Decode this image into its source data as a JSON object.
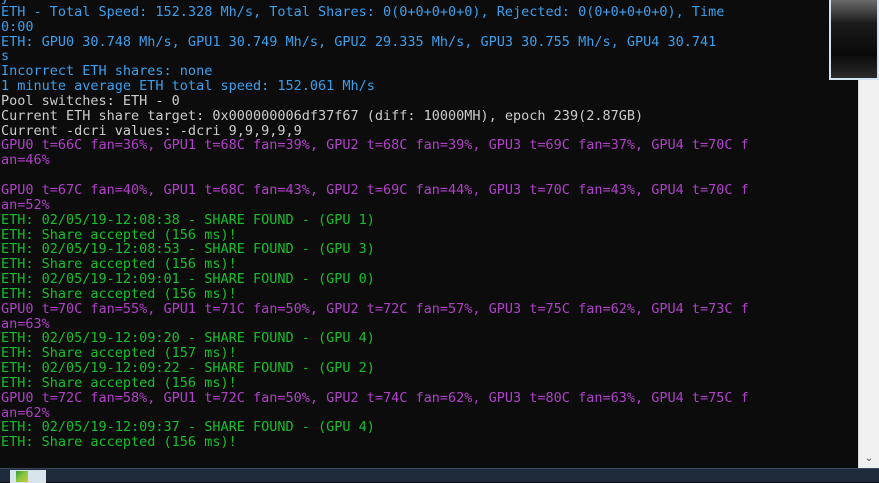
{
  "console": {
    "lines": [
      {
        "text": "y",
        "color": "blue"
      },
      {
        "text": "ETH - Total Speed: 152.328 Mh/s, Total Shares: 0(0+0+0+0+0), Rejected: 0(0+0+0+0+0), Time",
        "color": "blue"
      },
      {
        "text": "0:00",
        "color": "blue"
      },
      {
        "text": "ETH: GPU0 30.748 Mh/s, GPU1 30.749 Mh/s, GPU2 29.335 Mh/s, GPU3 30.755 Mh/s, GPU4 30.741",
        "color": "blue"
      },
      {
        "text": "s",
        "color": "blue"
      },
      {
        "text": "Incorrect ETH shares: none",
        "color": "blue"
      },
      {
        "text": "1 minute average ETH total speed: 152.061 Mh/s",
        "color": "blue"
      },
      {
        "text": "Pool switches: ETH - 0",
        "color": "white"
      },
      {
        "text": "Current ETH share target: 0x000000006df37f67 (diff: 10000MH), epoch 239(2.87GB)",
        "color": "white"
      },
      {
        "text": "Current -dcri values: -dcri 9,9,9,9,9",
        "color": "white"
      },
      {
        "text": "GPU0 t=66C fan=36%, GPU1 t=68C fan=39%, GPU2 t=68C fan=39%, GPU3 t=69C fan=37%, GPU4 t=70C f",
        "color": "purple"
      },
      {
        "text": "an=46%",
        "color": "purple"
      },
      {
        "text": "",
        "color": "white"
      },
      {
        "text": "GPU0 t=67C fan=40%, GPU1 t=68C fan=43%, GPU2 t=69C fan=44%, GPU3 t=70C fan=43%, GPU4 t=70C f",
        "color": "purple"
      },
      {
        "text": "an=52%",
        "color": "purple"
      },
      {
        "text": "ETH: 02/05/19-12:08:38 - SHARE FOUND - (GPU 1)",
        "color": "green"
      },
      {
        "text": "ETH: Share accepted (156 ms)!",
        "color": "green"
      },
      {
        "text": "ETH: 02/05/19-12:08:53 - SHARE FOUND - (GPU 3)",
        "color": "green"
      },
      {
        "text": "ETH: Share accepted (156 ms)!",
        "color": "green"
      },
      {
        "text": "ETH: 02/05/19-12:09:01 - SHARE FOUND - (GPU 0)",
        "color": "green"
      },
      {
        "text": "ETH: Share accepted (156 ms)!",
        "color": "green"
      },
      {
        "text": "GPU0 t=70C fan=55%, GPU1 t=71C fan=50%, GPU2 t=72C fan=57%, GPU3 t=75C fan=62%, GPU4 t=73C f",
        "color": "purple"
      },
      {
        "text": "an=63%",
        "color": "purple"
      },
      {
        "text": "ETH: 02/05/19-12:09:20 - SHARE FOUND - (GPU 4)",
        "color": "green"
      },
      {
        "text": "ETH: Share accepted (157 ms)!",
        "color": "green"
      },
      {
        "text": "ETH: 02/05/19-12:09:22 - SHARE FOUND - (GPU 2)",
        "color": "green"
      },
      {
        "text": "ETH: Share accepted (156 ms)!",
        "color": "green"
      },
      {
        "text": "GPU0 t=72C fan=58%, GPU1 t=72C fan=50%, GPU2 t=74C fan=62%, GPU3 t=80C fan=63%, GPU4 t=75C f",
        "color": "purple"
      },
      {
        "text": "an=62%",
        "color": "purple"
      },
      {
        "text": "ETH: 02/05/19-12:09:37 - SHARE FOUND - (GPU 4)",
        "color": "green"
      },
      {
        "text": "ETH: Share accepted (156 ms)!",
        "color": "green"
      }
    ]
  },
  "scrollbar": {
    "down_icon": "chevron-down-icon",
    "down_glyph": "⌄"
  },
  "colors": {
    "background": "#0c0c0c",
    "blue": "#3aa0ee",
    "white": "#cccccc",
    "purple": "#b040c8",
    "green": "#14c02a"
  }
}
